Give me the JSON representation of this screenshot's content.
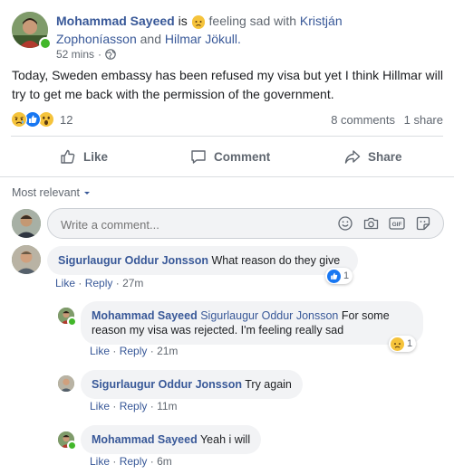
{
  "post": {
    "author": "Mohammad Sayeed",
    "is_text": "is",
    "feeling": "feeling sad",
    "with_text": "with",
    "tag1": "Kristján",
    "tag2_line": "Zophoníasson",
    "and_text": "and",
    "tag3": "Hilmar Jökull.",
    "time": "52 mins",
    "body": "Today, Sweden embassy has been refused my visa but yet I think Hillmar will try to get me back with the permission of the government.",
    "reaction_count": "12",
    "comments_count": "8 comments",
    "shares_count": "1 share"
  },
  "toolbar": {
    "like": "Like",
    "comment": "Comment",
    "share": "Share"
  },
  "sort": {
    "label": "Most relevant"
  },
  "composer": {
    "placeholder": "Write a comment..."
  },
  "comments": [
    {
      "author": "Sigurlaugur Oddur Jonsson",
      "text": "What reason do they give",
      "like": "Like",
      "reply": "Reply",
      "time": "27m",
      "reactions": "1"
    },
    {
      "author": "Mohammad Sayeed",
      "mention": "Sigurlaugur Oddur Jonsson",
      "text_line1": "For some",
      "text_line2": "reason my visa was rejected. I'm feeling really sad",
      "like": "Like",
      "reply": "Reply",
      "time": "21m",
      "reactions": "1"
    },
    {
      "author": "Sigurlaugur Oddur Jonsson",
      "text": "Try again",
      "like": "Like",
      "reply": "Reply",
      "time": "11m"
    },
    {
      "author": "Mohammad Sayeed",
      "text": "Yeah i will",
      "like": "Like",
      "reply": "Reply",
      "time": "6m"
    }
  ],
  "separator": "·",
  "colors": {
    "link": "#385898",
    "muted": "#606770",
    "bubble": "#f2f3f5",
    "online": "#42b72a",
    "like_blue": "#1877f2"
  }
}
